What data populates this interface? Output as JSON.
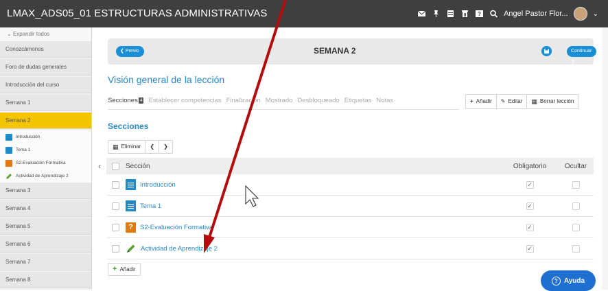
{
  "topbar": {
    "title": "LMAX_ADS05_01 ESTRUCTURAS ADMINISTRATIVAS",
    "user_name": "Angel Pastor Flor...",
    "icons": [
      "mail-icon",
      "pin-icon",
      "calendar-icon",
      "trash-icon",
      "help-icon",
      "search-icon"
    ]
  },
  "sidebar": {
    "expand_label": "Expandir todos",
    "items": [
      {
        "label": "Conozcámonos"
      },
      {
        "label": "Foro de dudas generales"
      },
      {
        "label": "Introducción del curso"
      },
      {
        "label": "Semana 1"
      },
      {
        "label": "Semana 2",
        "active": true
      }
    ],
    "sub_items": [
      {
        "label": "Introducción",
        "icon": "document-icon"
      },
      {
        "label": "Tema 1",
        "icon": "document-icon"
      },
      {
        "label": "S2-Evaluación Formativa",
        "icon": "quiz-icon"
      },
      {
        "label": "Actividad de Aprendizaje 2",
        "icon": "pencil-icon"
      }
    ],
    "more_items": [
      {
        "label": "Semana 3"
      },
      {
        "label": "Semana 4"
      },
      {
        "label": "Semana 5"
      },
      {
        "label": "Semana 6"
      },
      {
        "label": "Semana 7"
      },
      {
        "label": "Semana 8"
      }
    ]
  },
  "week_bar": {
    "prev_label": "Previo",
    "title": "SEMANA 2",
    "next_label": "Continuar"
  },
  "lesson": {
    "heading": "Visión general de la lección",
    "tabs": [
      {
        "label": "Secciones",
        "badge": "4",
        "active": true
      },
      {
        "label": "Establecer competencias"
      },
      {
        "label": "Finalización"
      },
      {
        "label": "Mostrado"
      },
      {
        "label": "Desbloqueado"
      },
      {
        "label": "Etiquetas"
      },
      {
        "label": "Notas"
      }
    ],
    "actions": {
      "add": "Añadir",
      "edit": "Editar",
      "delete": "Borrar lección"
    }
  },
  "sections": {
    "heading": "Secciones",
    "delete_label": "Eliminar",
    "columns": {
      "section": "Sección",
      "required": "Obligatorio",
      "hide": "Ocultar"
    },
    "rows": [
      {
        "title": "Introducción",
        "icon": "document-icon",
        "required": true,
        "hidden": false
      },
      {
        "title": "Tema 1",
        "icon": "document-icon",
        "required": true,
        "hidden": false
      },
      {
        "title": "S2-Evaluación Formativa",
        "icon": "quiz-icon",
        "required": true,
        "hidden": false
      },
      {
        "title": "Actividad de Aprendizaje 2",
        "icon": "pencil-icon",
        "required": true,
        "hidden": false
      }
    ],
    "add_label": "Añadir"
  },
  "help": {
    "label": "Ayuda"
  },
  "colors": {
    "topbar": "#3f3f3f",
    "accent": "#1a8fd6",
    "active_nav": "#f4c400",
    "annotation_arrow": "#b30c0c"
  }
}
